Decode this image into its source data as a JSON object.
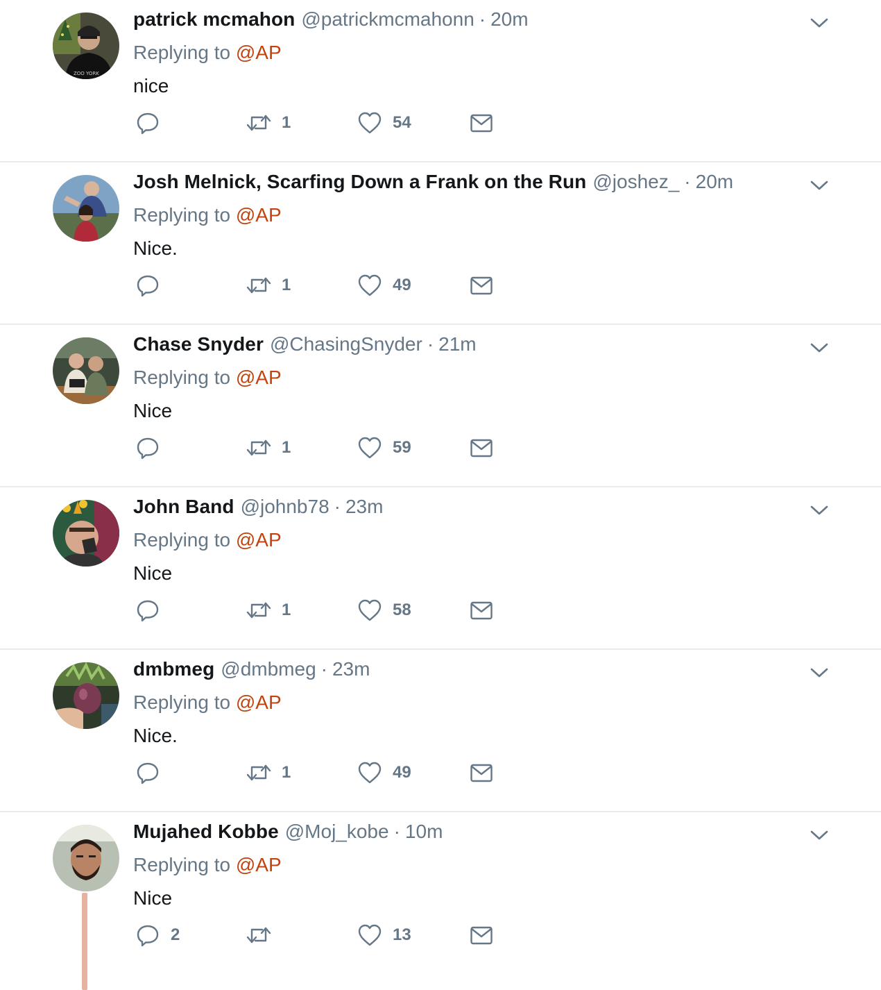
{
  "colors": {
    "mention": "#c1440e",
    "secondary_text": "#657786",
    "primary_text": "#14171a",
    "divider": "#e6ecf0",
    "thread_line": "#e6b3a1"
  },
  "icons": {
    "reply": "reply-icon",
    "retweet": "retweet-icon",
    "like": "heart-icon",
    "message": "envelope-icon",
    "more": "chevron-down-icon"
  },
  "tweets": [
    {
      "name": "patrick mcmahon",
      "handle": "@patrickmcmahonn",
      "separator": "·",
      "time": "20m",
      "replying_prefix": "Replying to",
      "replying_to": "@AP",
      "text": "nice",
      "replies": "",
      "retweets": "1",
      "likes": "54"
    },
    {
      "name": "Josh Melnick, Scarfing Down a Frank on the Run",
      "handle": "@joshez_",
      "separator": "·",
      "time": "20m",
      "replying_prefix": "Replying to",
      "replying_to": "@AP",
      "text": "Nice.",
      "replies": "",
      "retweets": "1",
      "likes": "49"
    },
    {
      "name": "Chase Snyder",
      "handle": "@ChasingSnyder",
      "separator": "·",
      "time": "21m",
      "replying_prefix": "Replying to",
      "replying_to": "@AP",
      "text": "Nice",
      "replies": "",
      "retweets": "1",
      "likes": "59"
    },
    {
      "name": "John Band",
      "handle": "@johnb78",
      "separator": "·",
      "time": "23m",
      "replying_prefix": "Replying to",
      "replying_to": "@AP",
      "text": "Nice",
      "replies": "",
      "retweets": "1",
      "likes": "58"
    },
    {
      "name": "dmbmeg",
      "handle": "@dmbmeg",
      "separator": "·",
      "time": "23m",
      "replying_prefix": "Replying to",
      "replying_to": "@AP",
      "text": "Nice.",
      "replies": "",
      "retweets": "1",
      "likes": "49"
    },
    {
      "name": "Mujahed Kobbe",
      "handle": "@Moj_kobe",
      "separator": "·",
      "time": "10m",
      "replying_prefix": "Replying to",
      "replying_to": "@AP",
      "text": "Nice",
      "replies": "2",
      "retweets": "",
      "likes": "13"
    }
  ]
}
